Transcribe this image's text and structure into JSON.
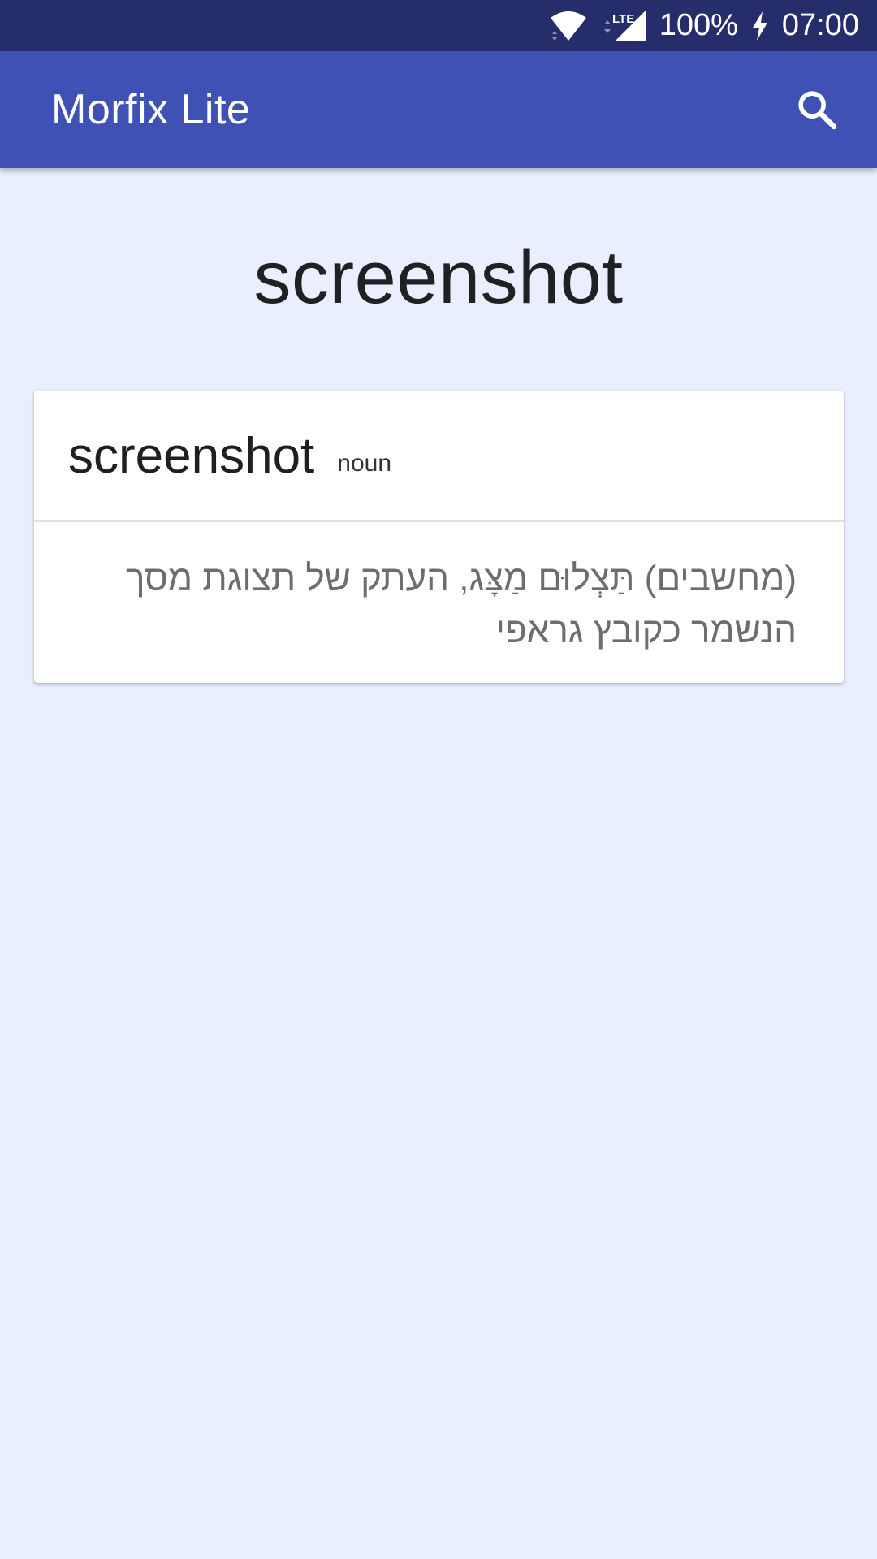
{
  "status_bar": {
    "network": "LTE",
    "battery": "100%",
    "time": "07:00",
    "icons": [
      "wifi-icon",
      "signal-icon",
      "charging-icon"
    ]
  },
  "app_bar": {
    "title": "Morfix Lite",
    "search_icon": "search-icon"
  },
  "search_term": "screenshot",
  "entries": [
    {
      "word": "screenshot",
      "part_of_speech": "noun",
      "translation": "(מחשבים) תַּצְלוּם מַצָּג, העתק של תצוגת מסך הנשמר כקובץ גראפי"
    }
  ],
  "colors": {
    "status_bar": "#252d6b",
    "app_bar": "#3f51b5",
    "background": "#e9effe",
    "card": "#ffffff"
  }
}
